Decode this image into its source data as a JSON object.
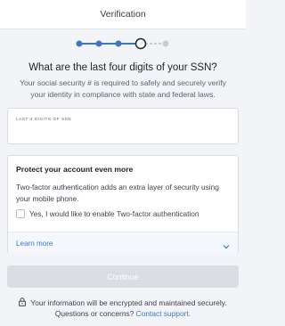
{
  "header": {
    "title": "Verification"
  },
  "stepper": {
    "total_steps": 5,
    "completed_steps": 3,
    "current_step": 4
  },
  "question": {
    "title": "What are the last four digits of your SSN?",
    "subtitle": "Your social security # is required to safely and securely verify your identity in compliance with state and federal laws."
  },
  "ssn_field": {
    "label": "LAST 4 DIGITS OF SSN",
    "value": ""
  },
  "two_factor": {
    "title": "Protect your account even more",
    "description": "Two-factor authentication adds an extra layer of security using your mobile phone.",
    "checkbox_label": "Yes, I would like to enable Two-factor authentication",
    "checked": false,
    "learn_more": "Learn more"
  },
  "continue_button": {
    "label": "Continue",
    "disabled": true
  },
  "footer": {
    "security_text": "Your information will be encrypted and maintained securely.",
    "questions_text": "Questions or concerns?",
    "support_link": "Contact support."
  },
  "colors": {
    "accent": "#3d77c9",
    "stepper_done": "#3d77c9",
    "stepper_pending": "#c9ccd3",
    "button_disabled": "#dadde3",
    "background": "#f3f4f7"
  }
}
